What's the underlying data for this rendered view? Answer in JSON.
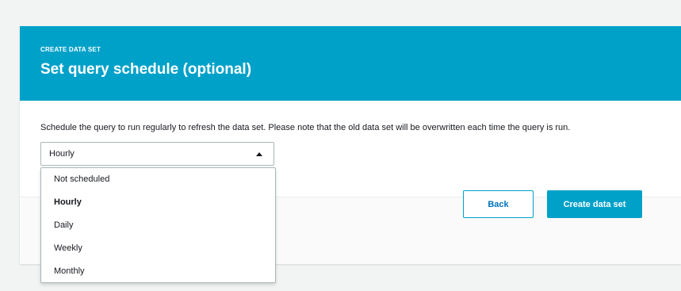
{
  "header": {
    "eyebrow": "CREATE DATA SET",
    "title": "Set query schedule (optional)"
  },
  "main": {
    "description": "Schedule the query to run regularly to refresh the data set. Please note that the old data set will be overwritten each time the query is run.",
    "schedule_select": {
      "value": "Hourly",
      "options": [
        "Not scheduled",
        "Hourly",
        "Daily",
        "Weekly",
        "Monthly"
      ],
      "expanded": true
    }
  },
  "footer": {
    "back_label": "Back",
    "create_label": "Create data set"
  },
  "colors": {
    "accent": "#00a1c9",
    "link": "#0073bb",
    "background": "#f2f3f3"
  },
  "icons": {
    "select_caret": "caret-up-icon"
  }
}
